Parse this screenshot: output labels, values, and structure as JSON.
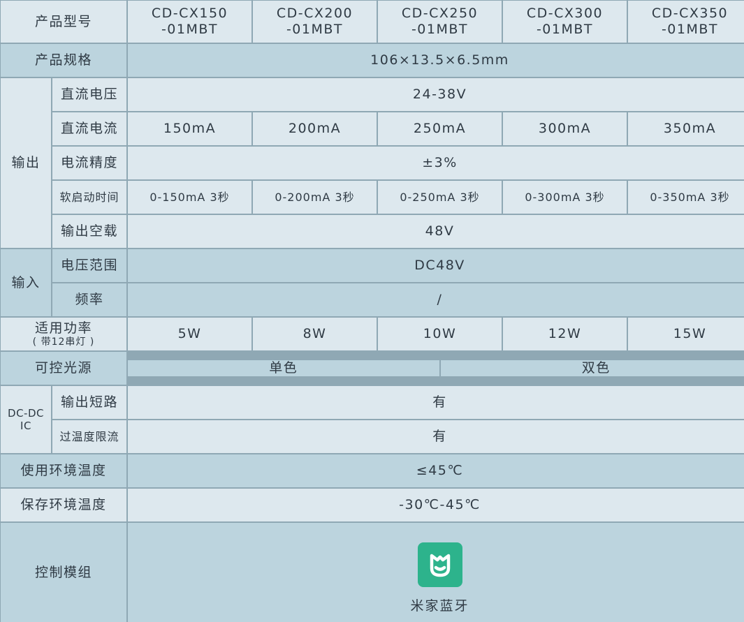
{
  "header": {
    "label": "产品型号",
    "models": [
      {
        "l1": "CD-CX150",
        "l2": "-01MBT"
      },
      {
        "l1": "CD-CX200",
        "l2": "-01MBT"
      },
      {
        "l1": "CD-CX250",
        "l2": "-01MBT"
      },
      {
        "l1": "CD-CX300",
        "l2": "-01MBT"
      },
      {
        "l1": "CD-CX350",
        "l2": "-01MBT"
      }
    ]
  },
  "spec": {
    "label": "产品规格",
    "value": "106×13.5×6.5mm"
  },
  "output": {
    "group_chars": [
      "输",
      "出"
    ],
    "voltage": {
      "label": "直流电压",
      "value": "24-38V"
    },
    "current": {
      "label": "直流电流",
      "values": [
        "150mA",
        "200mA",
        "250mA",
        "300mA",
        "350mA"
      ]
    },
    "accuracy": {
      "label": "电流精度",
      "value": "±3%"
    },
    "softstart": {
      "label": "软启动时间",
      "values": [
        "0-150mA 3秒",
        "0-200mA 3秒",
        "0-250mA 3秒",
        "0-300mA 3秒",
        "0-350mA 3秒"
      ]
    },
    "noload": {
      "label": "输出空载",
      "value": "48V"
    }
  },
  "input": {
    "group_chars": [
      "输",
      "入"
    ],
    "voltage_range": {
      "label": "电压范围",
      "value": "DC48V"
    },
    "frequency": {
      "label": "频率",
      "value": "/"
    }
  },
  "power": {
    "label_l1": "适用功率",
    "label_l2": "( 带12串灯 )",
    "values": [
      "5W",
      "8W",
      "10W",
      "12W",
      "15W"
    ]
  },
  "light_source": {
    "label": "可控光源",
    "single": "单色",
    "dual": "双色"
  },
  "ic": {
    "group_l1": "DC-DC",
    "group_l2": "IC",
    "short_circuit": {
      "label": "输出短路",
      "value": "有"
    },
    "over_temp": {
      "label": "过温度限流",
      "value": "有"
    }
  },
  "operating_temp": {
    "label": "使用环境温度",
    "value": "≤45℃"
  },
  "storage_temp": {
    "label": "保存环境温度",
    "value": "-30℃-45℃"
  },
  "control": {
    "label": "控制模组",
    "logo_text": "米家蓝牙",
    "logo_color": "#2db38c"
  }
}
